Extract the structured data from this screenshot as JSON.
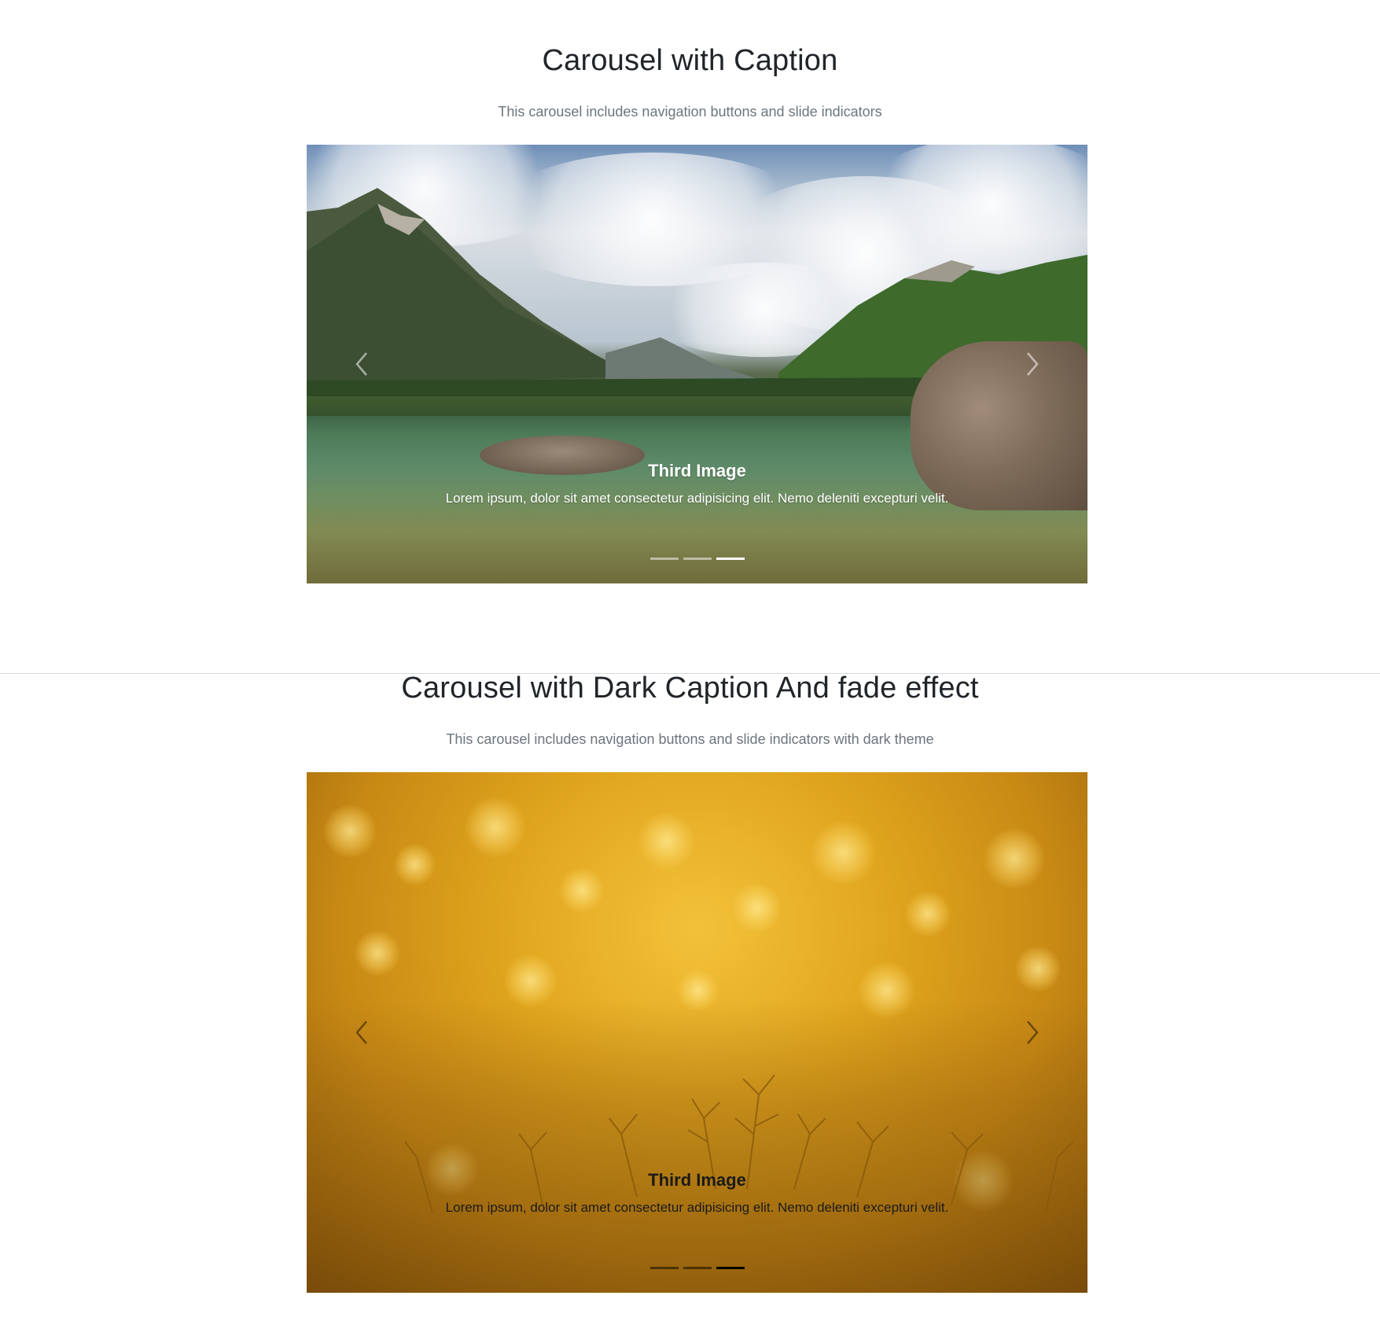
{
  "section1": {
    "title": "Carousel with Caption",
    "subtitle": "This carousel includes navigation buttons and slide indicators",
    "carousel": {
      "caption_title": "Third Image",
      "caption_text": "Lorem ipsum, dolor sit amet consectetur adipisicing elit. Nemo deleniti excepturi velit.",
      "indicator_count": 3,
      "active_indicator": 3,
      "theme": "light",
      "prev_icon": "chevron-left-icon",
      "next_icon": "chevron-right-icon"
    }
  },
  "section2": {
    "title": "Carousel with Dark Caption And fade effect",
    "subtitle": "This carousel includes navigation buttons and slide indicators with dark theme",
    "carousel": {
      "caption_title": "Third Image",
      "caption_text": "Lorem ipsum, dolor sit amet consectetur adipisicing elit. Nemo deleniti excepturi velit.",
      "indicator_count": 3,
      "active_indicator": 3,
      "theme": "dark",
      "prev_icon": "chevron-left-icon",
      "next_icon": "chevron-right-icon"
    }
  },
  "colors": {
    "heading": "#212529",
    "muted": "#6c757d",
    "divider": "#d6d8db"
  }
}
